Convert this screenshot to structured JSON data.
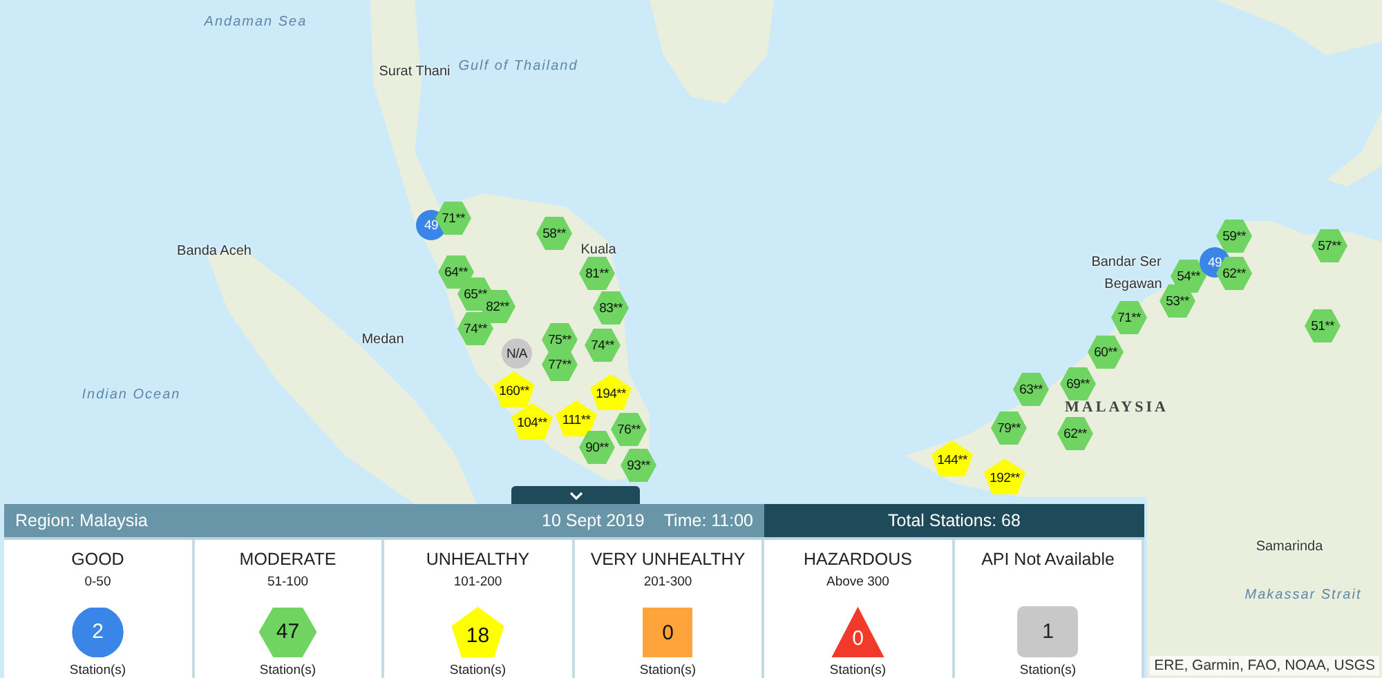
{
  "map": {
    "places": [
      {
        "label": "Andaman Sea",
        "kind": "sea"
      },
      {
        "label": "Gulf of Thailand",
        "kind": "sea"
      },
      {
        "label": "Surat Thani",
        "kind": "city"
      },
      {
        "label": "Banda Aceh",
        "kind": "city"
      },
      {
        "label": "Medan",
        "kind": "city"
      },
      {
        "label": "Indian Ocean",
        "kind": "sea"
      },
      {
        "label": "Kuala",
        "kind": "city"
      },
      {
        "label": "Bandar Ser",
        "kind": "city"
      },
      {
        "label": "Begawan",
        "kind": "city"
      },
      {
        "label": "MALAYSIA",
        "kind": "country"
      },
      {
        "label": "Samarinda",
        "kind": "city"
      },
      {
        "label": "Makassar Strait",
        "kind": "sea"
      }
    ],
    "markers": [
      {
        "value": "49",
        "kind": "good"
      },
      {
        "value": "71**",
        "kind": "moderate"
      },
      {
        "value": "58**",
        "kind": "moderate"
      },
      {
        "value": "59**",
        "kind": "moderate"
      },
      {
        "value": "57**",
        "kind": "moderate"
      },
      {
        "value": "64**",
        "kind": "moderate"
      },
      {
        "value": "81**",
        "kind": "moderate"
      },
      {
        "value": "54**",
        "kind": "moderate"
      },
      {
        "value": "49",
        "kind": "good"
      },
      {
        "value": "62**",
        "kind": "moderate"
      },
      {
        "value": "65**",
        "kind": "moderate"
      },
      {
        "value": "82**",
        "kind": "moderate"
      },
      {
        "value": "83**",
        "kind": "moderate"
      },
      {
        "value": "53**",
        "kind": "moderate"
      },
      {
        "value": "74**",
        "kind": "moderate"
      },
      {
        "value": "75**",
        "kind": "moderate"
      },
      {
        "value": "74**",
        "kind": "moderate"
      },
      {
        "value": "71**",
        "kind": "moderate"
      },
      {
        "value": "51**",
        "kind": "moderate"
      },
      {
        "value": "N/A",
        "kind": "na"
      },
      {
        "value": "77**",
        "kind": "moderate"
      },
      {
        "value": "60**",
        "kind": "moderate"
      },
      {
        "value": "160**",
        "kind": "unhealthy"
      },
      {
        "value": "194**",
        "kind": "unhealthy"
      },
      {
        "value": "63**",
        "kind": "moderate"
      },
      {
        "value": "69**",
        "kind": "moderate"
      },
      {
        "value": "104**",
        "kind": "unhealthy"
      },
      {
        "value": "111**",
        "kind": "unhealthy"
      },
      {
        "value": "90**",
        "kind": "moderate"
      },
      {
        "value": "76**",
        "kind": "moderate"
      },
      {
        "value": "79**",
        "kind": "moderate"
      },
      {
        "value": "62**",
        "kind": "moderate"
      },
      {
        "value": "93**",
        "kind": "moderate"
      },
      {
        "value": "144**",
        "kind": "unhealthy"
      },
      {
        "value": "192**",
        "kind": "unhealthy"
      }
    ],
    "attribution": "ERE, Garmin, FAO, NOAA, USGS"
  },
  "panel": {
    "region": "Region: Malaysia",
    "date": "10 Sept 2019",
    "time": "Time: 11:00",
    "total": "Total Stations: 68",
    "categories": [
      {
        "name": "GOOD",
        "range": "0-50",
        "count": "2",
        "unit": "Station(s)",
        "kind": "good"
      },
      {
        "name": "MODERATE",
        "range": "51-100",
        "count": "47",
        "unit": "Station(s)",
        "kind": "moderate"
      },
      {
        "name": "UNHEALTHY",
        "range": "101-200",
        "count": "18",
        "unit": "Station(s)",
        "kind": "unhealthy"
      },
      {
        "name": "VERY UNHEALTHY",
        "range": "201-300",
        "count": "0",
        "unit": "Station(s)",
        "kind": "very_unhealthy"
      },
      {
        "name": "HAZARDOUS",
        "range": "Above 300",
        "count": "0",
        "unit": "Station(s)",
        "kind": "hazardous"
      },
      {
        "name": "API Not Available",
        "count": "1",
        "unit": "Station(s)",
        "kind": "na"
      }
    ]
  }
}
